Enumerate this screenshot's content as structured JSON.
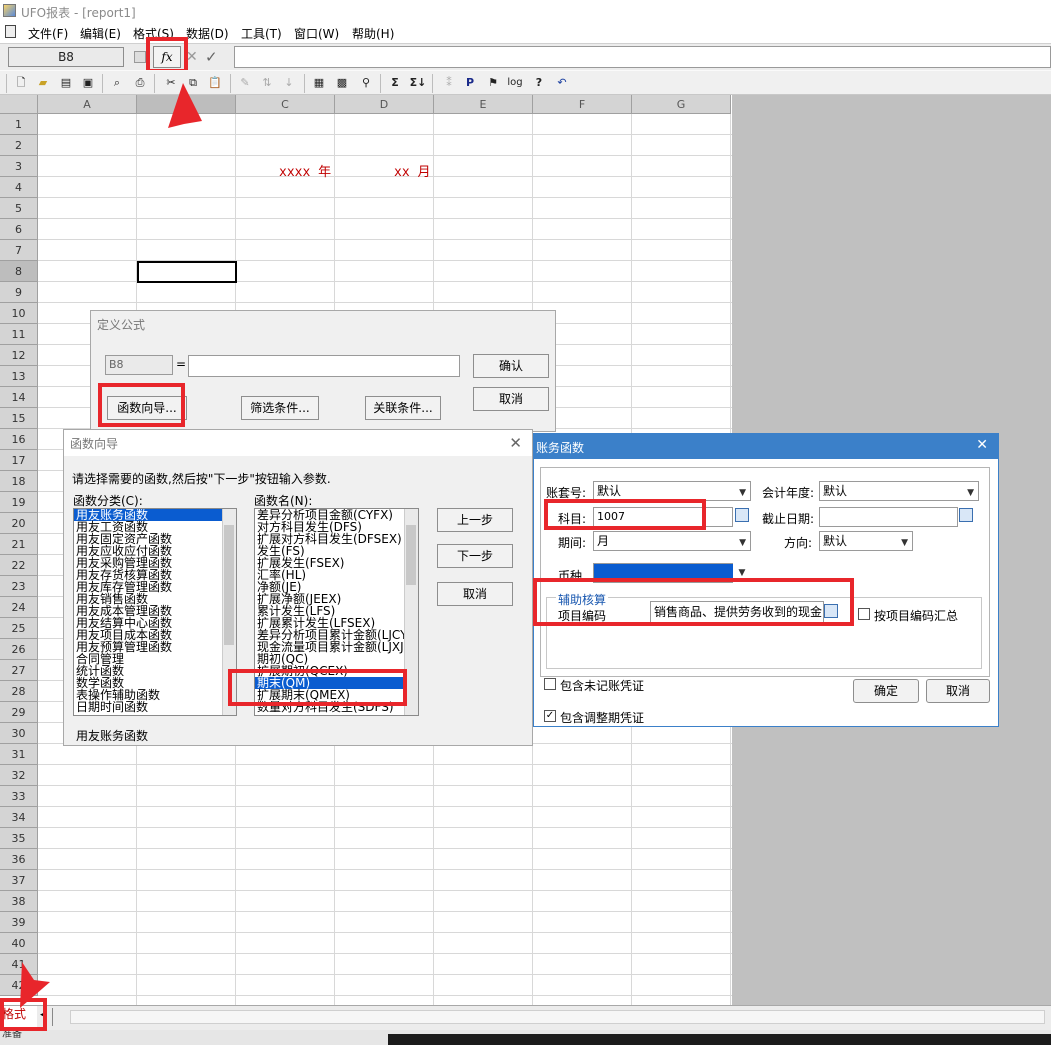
{
  "app": {
    "title": "UFO报表 - [report1]"
  },
  "menu": [
    "文件(F)",
    "编辑(E)",
    "格式(S)",
    "数据(D)",
    "工具(T)",
    "窗口(W)",
    "帮助(H)"
  ],
  "formula_bar": {
    "cell_ref": "B8",
    "fx": "fx"
  },
  "grid": {
    "columns": [
      "A",
      "B",
      "C",
      "D",
      "E",
      "F",
      "G"
    ],
    "rows": [
      "1",
      "2",
      "3",
      "4",
      "5",
      "6",
      "7",
      "8",
      "9",
      "10",
      "11",
      "12",
      "13",
      "14",
      "15",
      "16",
      "17",
      "18",
      "19",
      "20",
      "21",
      "22",
      "23",
      "24",
      "25",
      "26",
      "27",
      "28",
      "29",
      "30",
      "31",
      "32",
      "33",
      "34",
      "35",
      "36",
      "37",
      "38",
      "39",
      "40",
      "41",
      "42"
    ],
    "cell_text_year": "xxxx 年",
    "cell_text_month": "xx 月"
  },
  "sheet_bar": {
    "mode_label": "格式",
    "status": "准备"
  },
  "define_formula": {
    "title": "定义公式",
    "cell": "B8",
    "equals": "=",
    "confirm": "确认",
    "cancel": "取消",
    "func_wizard": "函数向导...",
    "filter": "筛选条件...",
    "relation": "关联条件..."
  },
  "func_wizard": {
    "title": "函数向导",
    "instruction": "请选择需要的函数,然后按\"下一步\"按钮输入参数.",
    "category_label": "函数分类(C):",
    "name_label": "函数名(N):",
    "categories": [
      "用友账务函数",
      "用友工资函数",
      "用友固定资产函数",
      "用友应收应付函数",
      "用友采购管理函数",
      "用友存货核算函数",
      "用友库存管理函数",
      "用友销售函数",
      "用友成本管理函数",
      "用友结算中心函数",
      "用友项目成本函数",
      "用友预算管理函数",
      "合同管理",
      "统计函数",
      "数学函数",
      "表操作辅助函数",
      "日期时间函数"
    ],
    "functions": [
      "差异分析项目金额(CYFX)",
      "对方科目发生(DFS)",
      "扩展对方科目发生(DFSEX)",
      "发生(FS)",
      "扩展发生(FSEX)",
      "汇率(HL)",
      "净额(JE)",
      "扩展净额(JEEX)",
      "累计发生(LFS)",
      "扩展累计发生(LFSEX)",
      "差异分析项目累计金额(LJCY)",
      "现金流量项目累计金额(LJXJ)",
      "期初(QC)",
      "扩展期初(QCEX)",
      "期末(QM)",
      "扩展期末(QMEX)",
      "数量对方科目发生(SDFS)"
    ],
    "prev": "上一步",
    "next": "下一步",
    "cancel": "取消",
    "footer": "用友账务函数"
  },
  "account_func": {
    "title": "账务函数",
    "account_set_label": "账套号:",
    "account_set": "默认",
    "year_label": "会计年度:",
    "year": "默认",
    "subject_label": "科目:",
    "subject": "1007",
    "end_date_label": "截止日期:",
    "end_date": "",
    "period_label": "期间:",
    "period": "月",
    "direction_label": "方向:",
    "direction": "默认",
    "currency_label": "币种",
    "aux_label": "辅助核算",
    "item_code_label": "项目编码",
    "item_code": "销售商品、提供劳务收到的现金",
    "summary_label": "按项目编码汇总",
    "unposted_label": "包含未记账凭证",
    "adjust_label": "包含调整期凭证",
    "ok": "确定",
    "cancel": "取消"
  },
  "colors": {
    "highlight": "#e8262b",
    "selected": "#0a5cd0",
    "dialog_title": "#3b80c9",
    "cell_text": "#c00000"
  }
}
